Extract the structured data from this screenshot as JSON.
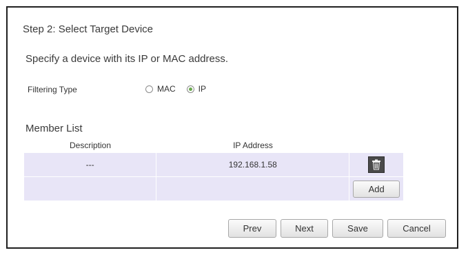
{
  "step_title": "Step 2: Select Target Device",
  "instruction": "Specify a device with its IP or MAC address.",
  "filtering": {
    "label": "Filtering Type",
    "options": [
      {
        "label": "MAC",
        "checked": false
      },
      {
        "label": "IP",
        "checked": true
      }
    ]
  },
  "member_list": {
    "title": "Member List",
    "columns": {
      "description": "Description",
      "ip": "IP Address"
    },
    "rows": [
      {
        "description": "---",
        "ip": "192.168.1.58"
      }
    ],
    "add_label": "Add"
  },
  "buttons": {
    "prev": "Prev",
    "next": "Next",
    "save": "Save",
    "cancel": "Cancel"
  },
  "icons": {
    "delete": "trash-icon"
  },
  "colors": {
    "row_bg": "#e8e5f7",
    "radio_selected": "#6aa84f"
  }
}
